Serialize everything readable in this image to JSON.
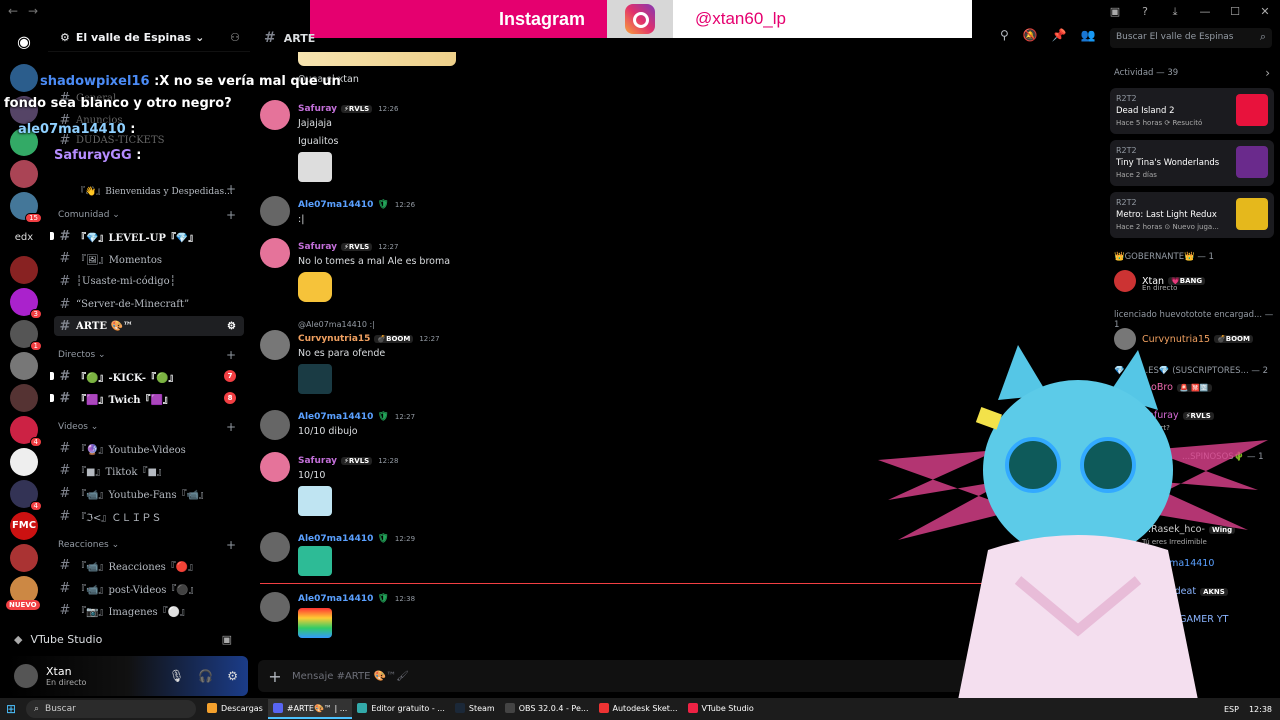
{
  "banner": {
    "platform": "Instagram",
    "handle": "@xtan60_lp"
  },
  "guild": {
    "name": "El valle de Espinas"
  },
  "overlay_chat": [
    {
      "user": "shadowpixel16",
      "text": ":X no se vería mal que un",
      "text2": "fondo sea blanco y otro negro?",
      "color": "#4b8bf5"
    },
    {
      "user": "ale07ma14410",
      "text": ":",
      "color": "#8fd0ff"
    },
    {
      "user": "SafurayGG",
      "text": ":",
      "color": "#b58cff"
    }
  ],
  "channels": {
    "hidden_top": [
      "General",
      "Anuncios",
      "DUDAS-TICKETS"
    ],
    "welcome": "『👋』Bienvenidas y Despedidas...",
    "sections": [
      {
        "name": "Comunidad",
        "items": [
          "『💎』LEVEL-UP『💎』",
          "『🖼』Momentos",
          "┆Usaste-mi-código┆",
          "“Server-de-Minecraft”",
          "ARTE 🎨™"
        ]
      },
      {
        "name": "Directos",
        "items": [
          "『🟢』-KICK-『🟢』",
          "『🟪』Twich『🟪』"
        ],
        "badges": [
          "7",
          "8"
        ]
      },
      {
        "name": "Videos",
        "items": [
          "『🔮』Youtube-Videos",
          "『■』Tiktok『■』",
          "『📹』Youtube-Fans『📹』",
          "『ℑ<』ＣＬＩＰＳ"
        ]
      },
      {
        "name": "Reacciones",
        "items": [
          "『📹』Reacciones『🔴』",
          "『📹』post-Videos『⚫』",
          "『📷』Imagenes『⚪』"
        ]
      }
    ],
    "new_badge": "NUEVO"
  },
  "voice": {
    "label": "VTube Studio"
  },
  "user": {
    "name": "Xtan",
    "status": "En directo"
  },
  "chat": {
    "channel": "ARTE",
    "search_placeholder": "Buscar El valle de Espinas",
    "composer_placeholder": "Mensaje #ARTE 🎨™🖌",
    "top_text": "Quea el xtan",
    "messages": [
      {
        "name": "Safuray",
        "tag": "⚡RVLS",
        "time": "12:26",
        "lines": [
          "Jajajaja",
          "Igualitos"
        ]
      },
      {
        "name": "Ale07ma14410",
        "tag": "",
        "time": "12:26",
        "lines": [
          ":|"
        ]
      },
      {
        "name": "Safuray",
        "tag": "⚡RVLS",
        "time": "12:27",
        "lines": [
          "No lo tomes a mal Ale es broma"
        ]
      },
      {
        "name": "Curvynutria15",
        "tag": "💣BOOM",
        "time": "12:27",
        "reply": "@Ale07ma14410 :|",
        "lines": [
          "No es para ofende"
        ]
      },
      {
        "name": "Ale07ma14410",
        "tag": "",
        "time": "12:27",
        "lines": [
          "10/10 dibujo"
        ]
      },
      {
        "name": "Safuray",
        "tag": "⚡RVLS",
        "time": "12:28",
        "lines": [
          "10/10"
        ]
      },
      {
        "name": "Ale07ma14410",
        "tag": "",
        "time": "12:29",
        "lines": []
      },
      {
        "name": "Ale07ma14410",
        "tag": "",
        "time": "12:38",
        "lines": []
      }
    ]
  },
  "members": {
    "activity_title": "Actividad — 39",
    "activities": [
      {
        "who": "R2T2",
        "game": "Dead Island 2",
        "when": "Hace 5 horas  ⟳ Resucitó"
      },
      {
        "who": "R2T2",
        "game": "Tiny Tina's Wonderlands",
        "when": "Hace 2 días"
      },
      {
        "who": "R2T2",
        "game": "Metro: Last Light Redux",
        "when": "Hace 2 horas  ⊙ Nuevo juga..."
      }
    ],
    "groups": [
      {
        "title": "👑GOBERNANTE👑 — 1"
      },
      {
        "title": "licenciado huevototote encargad... — 1"
      },
      {
        "title": "💎 DU...ES💎 (SUSCRIPTORES... — 2"
      },
      {
        "title": "...SPINOSOS🌵 — 1"
      }
    ],
    "people": [
      {
        "name": "Xtan",
        "tag": "💗BANG",
        "sub": "En directo",
        "color": "#ffffff"
      },
      {
        "name": "Curvynutria15",
        "tag": "💣BOOM",
        "sub": "",
        "color": "#f0a060"
      },
      {
        "name": "...oBro",
        "tag": "🚨 🈲🈳",
        "sub": "",
        "color": "#f06ab0"
      },
      {
        "name": "Safuray",
        "tag": "⚡RVLS",
        "sub": "Un fort?",
        "color": "#d66bd6"
      },
      {
        "name": "...Rasek_hco-",
        "tag": "Wing",
        "sub": "Tú eres Irredimible",
        "color": "#ccc"
      },
      {
        "name": "Ale07ma14410",
        "tag": "",
        "sub": "",
        "color": "#5aa0ff"
      },
      {
        "name": "...cCKkdeat",
        "tag": "AKNS",
        "sub": "",
        "color": "#8ab4ff"
      },
      {
        "name": "...RLOS GAMER YT",
        "tag": "",
        "sub": "",
        "color": "#8ab4ff"
      }
    ]
  },
  "taskbar": {
    "search": "Buscar",
    "apps": [
      "Descargas",
      "#ARTE🎨™ | ...",
      "Editor gratuito - ...",
      "Steam",
      "OBS 32.0.4 - Pe...",
      "Autodesk Sket...",
      "VTube Studio"
    ],
    "lang": "ESP",
    "time": "12:38"
  }
}
